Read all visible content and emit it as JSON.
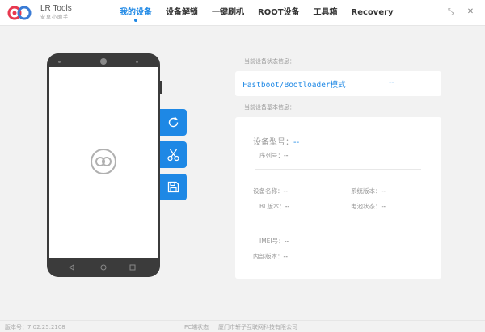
{
  "app": {
    "name": "LR Tools",
    "subtitle": "安卓小助手"
  },
  "nav": {
    "tabs": [
      {
        "label": "我的设备",
        "active": true
      },
      {
        "label": "设备解锁"
      },
      {
        "label": "一键刷机"
      },
      {
        "label": "ROOT设备"
      },
      {
        "label": "工具箱"
      },
      {
        "label": "Recovery"
      }
    ]
  },
  "window": {
    "restore_glyph": "⤡",
    "close_glyph": "✕"
  },
  "status": {
    "label": "当前设备状态信息：",
    "mode": "Fastboot/Bootloader模式",
    "value": "--"
  },
  "basic": {
    "label": "当前设备基本信息：",
    "model_label": "设备型号：",
    "model_value": "--",
    "serial_label": "序列号：",
    "serial_value": "--",
    "name_label": "设备名称：",
    "name_value": "--",
    "sysver_label": "系统版本：",
    "sysver_value": "--",
    "bl_label": "BL版本：",
    "bl_value": "--",
    "battery_label": "电池状态：",
    "battery_value": "--",
    "imei_label": "IMEI号：",
    "imei_value": "--",
    "kernel_label": "内部版本：",
    "kernel_value": "--"
  },
  "footer": {
    "version": "版本号：7.02.25.2108",
    "pc_status": "PC端状态",
    "company": "厦门市轩子互联网科技有限公司"
  },
  "colors": {
    "accent": "#1e88e5",
    "phone": "#3b3b3b"
  }
}
